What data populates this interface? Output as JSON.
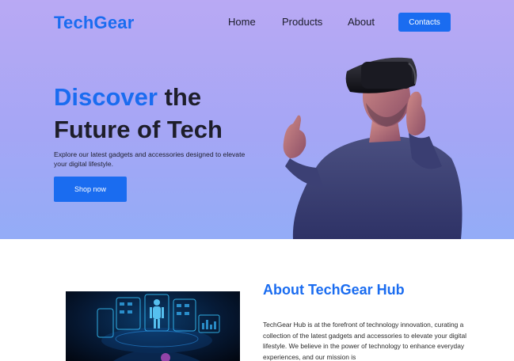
{
  "header": {
    "logo": "TechGear",
    "nav": [
      {
        "label": "Home"
      },
      {
        "label": "Products"
      },
      {
        "label": "About"
      }
    ],
    "contacts_label": "Contacts"
  },
  "hero": {
    "headline_accent": "Discover",
    "headline_rest_line1": " the",
    "headline_line2": "Future of Tech",
    "subtext": "Explore our latest gadgets and accessories designed to elevate your digital lifestyle.",
    "cta_label": "Shop now",
    "image_icon": "vr-headset-person-image"
  },
  "about": {
    "title": "About TechGear Hub",
    "body": "TechGear Hub is at the forefront of technology innovation, curating a collection of the latest gadgets and accessories to elevate your digital lifestyle. We believe in the power of technology to enhance everyday experiences, and our mission is",
    "image_icon": "holographic-interface-image"
  },
  "colors": {
    "brand": "#1a6cf0",
    "hero_gradient_top": "#b9a9f4",
    "hero_gradient_bottom": "#93acf7",
    "text_dark": "#1e1e2a"
  }
}
